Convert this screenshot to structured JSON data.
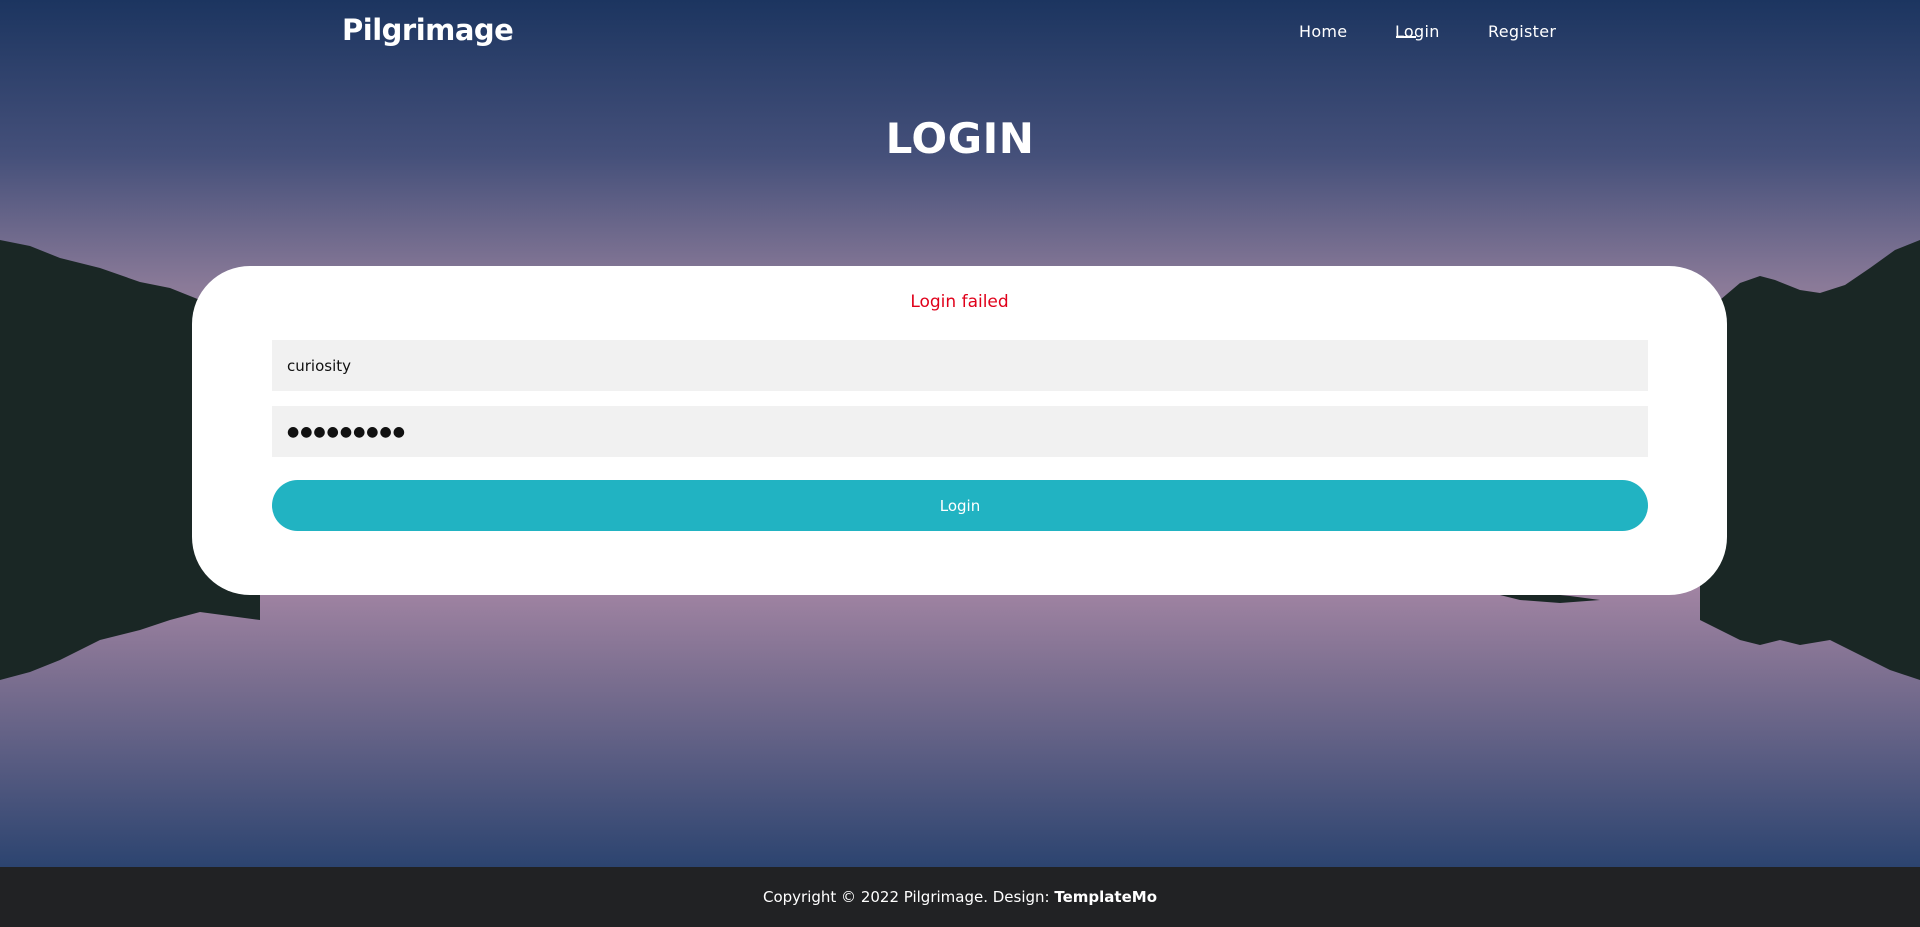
{
  "brand": {
    "name": "Pilgrimage"
  },
  "nav": {
    "items": [
      {
        "label": "Home"
      },
      {
        "label": "Login",
        "active": true
      },
      {
        "label": "Register"
      }
    ]
  },
  "page": {
    "title": "LOGIN"
  },
  "form": {
    "error": "Login failed",
    "username_value": "curiosity",
    "password_masked": "●●●●●●●●●",
    "submit_label": "Login"
  },
  "footer": {
    "copyright": "Copyright © 2022 Pilgrimage. Design: ",
    "design_link": "TemplateMo"
  },
  "colors": {
    "accent": "#21b3c2",
    "error": "#e0001a",
    "footer_bg": "#212224"
  }
}
